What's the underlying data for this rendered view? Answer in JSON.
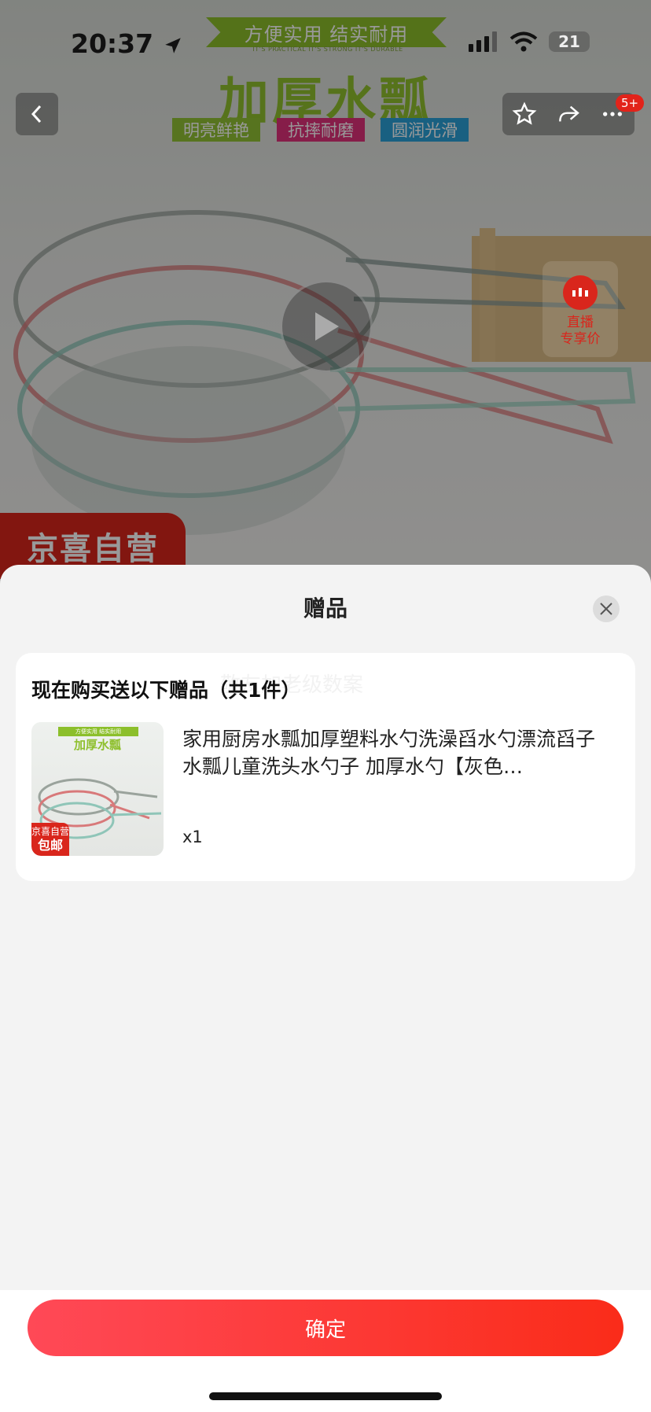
{
  "status_bar": {
    "time": "20:37",
    "battery": "21"
  },
  "hero": {
    "banner_top": "方便实用 结实耐用",
    "banner_sub": "IT'S PRACTICAL IT'S STRONG IT'S DURABLE",
    "title": "加厚水瓢",
    "tags": [
      "明亮鲜艳",
      "抗摔耐磨",
      "圆润光滑"
    ],
    "self_operated": "京喜自营",
    "live_label": "直播\n专享价",
    "badge": "5+"
  },
  "sheet": {
    "title": "赠品",
    "card_title": "现在购买送以下赠品（共1件）",
    "ghost_text": "敬友加老级数案",
    "gift": {
      "name": "家用厨房水瓢加厚塑料水勺洗澡舀水勺漂流舀子水瓢儿童洗头水勺子 加厚水勺【灰色…",
      "qty": "x1",
      "thumb_title": "加厚水瓢",
      "thumb_badge_top": "京喜自营",
      "thumb_badge_bottom": "包邮"
    }
  },
  "footer": {
    "confirm": "确定"
  },
  "colors": {
    "accent": "#fa2c19",
    "brand_green": "#8fc02e",
    "jd_red": "#d9261c"
  },
  "icons": [
    "back-icon",
    "star-icon",
    "share-icon",
    "more-icon",
    "play-icon",
    "live-icon",
    "close-icon",
    "location-arrow-icon",
    "signal-icon",
    "wifi-icon"
  ]
}
